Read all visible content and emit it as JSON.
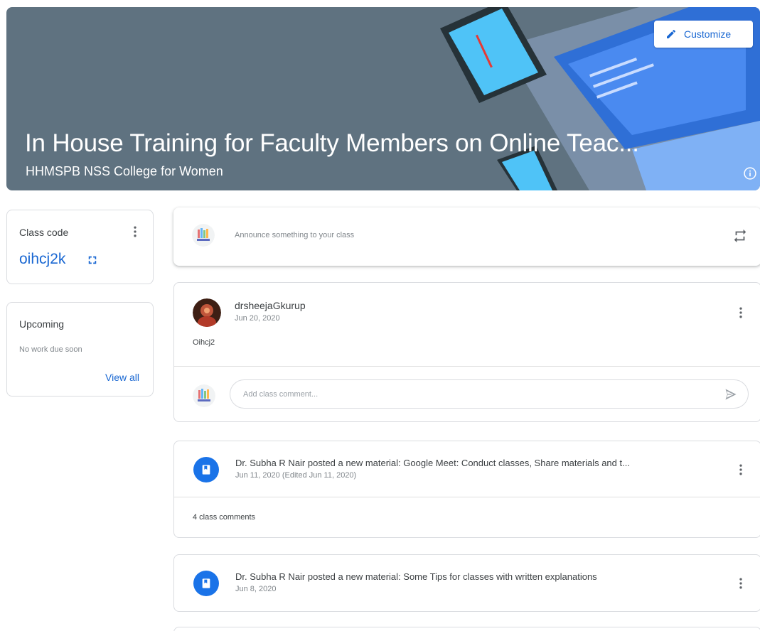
{
  "banner": {
    "customize_label": "Customize",
    "title": "In House Training for Faculty Members on Online Teac...",
    "subtitle": "HHMSPB NSS College for Women",
    "color": "#5f7280"
  },
  "class_code": {
    "label": "Class code",
    "value": "oihcj2k"
  },
  "upcoming": {
    "title": "Upcoming",
    "empty_text": "No work due soon",
    "view_all_label": "View all"
  },
  "announce": {
    "placeholder": "Announce something to your class"
  },
  "posts": [
    {
      "author": "drsheejaGkurup",
      "date": "Jun 20, 2020",
      "body": "Oihcj2",
      "comment_placeholder": "Add class comment..."
    }
  ],
  "materials": [
    {
      "title": "Dr. Subha R Nair posted a new material: Google Meet: Conduct classes, Share materials and t...",
      "date": "Jun 11, 2020 (Edited Jun 11, 2020)",
      "comments": "4 class comments"
    },
    {
      "title": "Dr. Subha R Nair posted a new material: Some Tips for classes with written explanations",
      "date": "Jun 8, 2020"
    }
  ],
  "colors": {
    "accent": "#1967d2",
    "material_icon_bg": "#1a73e8"
  },
  "icons": [
    "pencil-icon",
    "info-icon",
    "more-vert-icon",
    "fullscreen-icon",
    "repost-icon",
    "send-icon",
    "material-doc-icon"
  ]
}
